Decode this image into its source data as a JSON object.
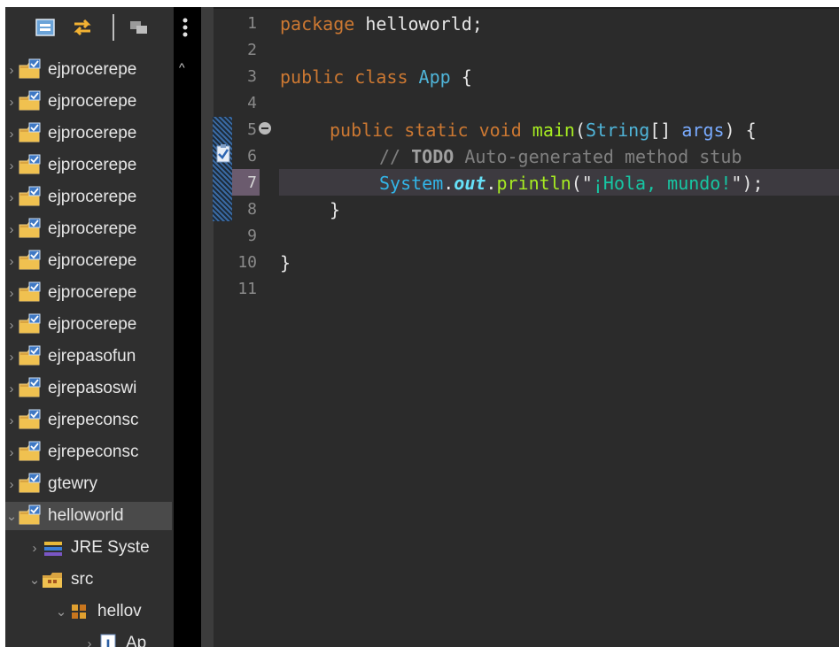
{
  "explorer": {
    "projects": [
      {
        "label": "ejprocerepe",
        "expanded": false
      },
      {
        "label": "ejprocerepe",
        "expanded": false
      },
      {
        "label": "ejprocerepe",
        "expanded": false
      },
      {
        "label": "ejprocerepe",
        "expanded": false
      },
      {
        "label": "ejprocerepe",
        "expanded": false
      },
      {
        "label": "ejprocerepe",
        "expanded": false
      },
      {
        "label": "ejprocerepe",
        "expanded": false
      },
      {
        "label": "ejprocerepe",
        "expanded": false
      },
      {
        "label": "ejprocerepe",
        "expanded": false
      },
      {
        "label": "ejrepasofun",
        "expanded": false
      },
      {
        "label": "ejrepasoswi",
        "expanded": false
      },
      {
        "label": "ejrepeconsc",
        "expanded": false
      },
      {
        "label": "ejrepeconsc",
        "expanded": false
      },
      {
        "label": "gtewry",
        "expanded": false
      }
    ],
    "selected_project": "helloworld",
    "children": {
      "jre": "JRE Syste",
      "src": "src",
      "package": "hellov",
      "file": "Ap"
    }
  },
  "editor": {
    "line_numbers": [
      "1",
      "2",
      "3",
      "4",
      "5",
      "6",
      "7",
      "8",
      "9",
      "10",
      "11"
    ],
    "active_line": "7",
    "lines": {
      "l1": {
        "kw": "package",
        "rest": " helloworld;"
      },
      "l3": {
        "kw": "public class",
        "cls": "App",
        "rest": " {"
      },
      "l5": {
        "kw": "public static void",
        "fn": "main",
        "p1": "(",
        "cls": "String",
        "p2": "[] ",
        "param": "args",
        "p3": ") {"
      },
      "l6": {
        "cmt1": "// ",
        "todo": "TODO",
        "cmt2": " Auto-generated method stub"
      },
      "l7": {
        "sys": "System",
        "dot1": ".",
        "field": "out",
        "dot2": ".",
        "fn": "println",
        "p1": "(\"",
        "str": "¡Hola, mundo!",
        "p2": "\");"
      },
      "l8": {
        "rest": "}"
      },
      "l10": {
        "rest": "}"
      }
    }
  },
  "colors": {
    "explorer_bg": "#2f2f2f",
    "editor_bg": "#2b2b2b",
    "keyword": "#cc7832",
    "class_name": "#4fb4d8",
    "method": "#a7ec21",
    "string": "#17c6a3",
    "comment": "#808080"
  }
}
